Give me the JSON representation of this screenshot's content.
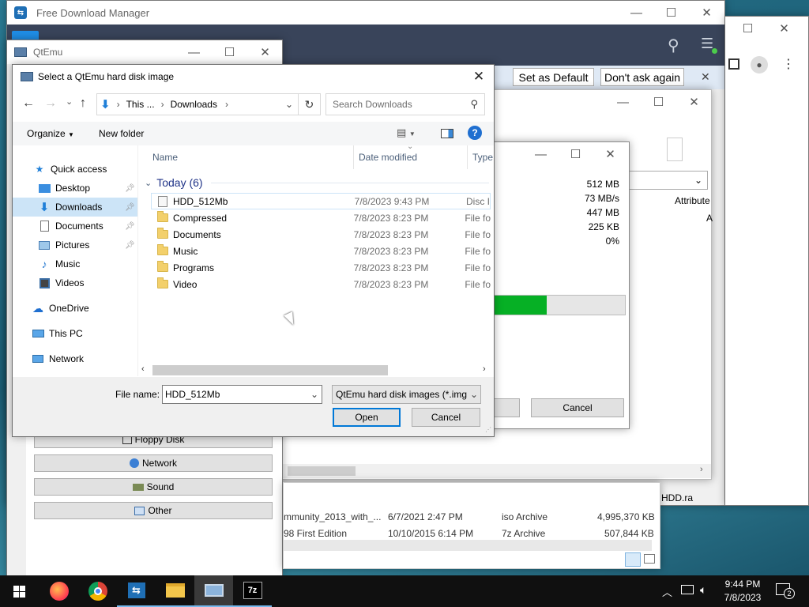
{
  "fdm": {
    "title": "Free Download Manager",
    "notif_set_default": "Set as Default",
    "notif_dont_ask": "Don't ask again",
    "stats": [
      "512 MB",
      "73 MB/s",
      "447 MB",
      "225 KB",
      "0%"
    ],
    "progress_fraction": 0.41,
    "cancel_label": "Cancel",
    "attributes_label": "Attribute",
    "files": [
      {
        "name": "mmunity_2013_with_...",
        "date": "6/7/2021 2:47 PM",
        "type": "iso Archive",
        "size": "4,995,370 KB"
      },
      {
        "name": "98 First Edition",
        "date": "10/10/2015 6:14 PM",
        "type": "7z Archive",
        "size": "507,844 KB"
      }
    ],
    "hdd_hint": "HDD.ra"
  },
  "qtemu": {
    "title": "QtEmu",
    "buttons": [
      "Floppy Disk",
      "Network",
      "Sound",
      "Other"
    ]
  },
  "dialog": {
    "title": "Select a QtEmu hard disk image",
    "breadcrumb": [
      "This ...",
      "Downloads"
    ],
    "search_placeholder": "Search Downloads",
    "organize": "Organize",
    "new_folder": "New folder",
    "columns": {
      "name": "Name",
      "date": "Date modified",
      "type": "Type"
    },
    "group": "Today (6)",
    "files": [
      {
        "name": "HDD_512Mb",
        "date": "7/8/2023 9:43 PM",
        "type": "Disc I",
        "kind": "disc"
      },
      {
        "name": "Compressed",
        "date": "7/8/2023 8:23 PM",
        "type": "File fo",
        "kind": "folder"
      },
      {
        "name": "Documents",
        "date": "7/8/2023 8:23 PM",
        "type": "File fo",
        "kind": "folder"
      },
      {
        "name": "Music",
        "date": "7/8/2023 8:23 PM",
        "type": "File fo",
        "kind": "folder"
      },
      {
        "name": "Programs",
        "date": "7/8/2023 8:23 PM",
        "type": "File fo",
        "kind": "folder"
      },
      {
        "name": "Video",
        "date": "7/8/2023 8:23 PM",
        "type": "File fo",
        "kind": "folder"
      }
    ],
    "nav": {
      "quick_access": "Quick access",
      "desktop": "Desktop",
      "downloads": "Downloads",
      "documents": "Documents",
      "pictures": "Pictures",
      "music": "Music",
      "videos": "Videos",
      "onedrive": "OneDrive",
      "this_pc": "This PC",
      "network": "Network"
    },
    "file_name_label": "File name:",
    "file_name_value": "HDD_512Mb",
    "filter": "QtEmu hard disk images (*.img",
    "open": "Open",
    "cancel": "Cancel"
  },
  "taskbar": {
    "time": "9:44 PM",
    "date": "7/8/2023",
    "notification_count": "2",
    "apps": [
      "firefox",
      "chrome",
      "free-download-manager",
      "file-explorer",
      "qtemu",
      "7-zip"
    ]
  },
  "colors": {
    "accent": "#0078d7",
    "progress": "#06b025",
    "taskbar": "#101010"
  }
}
